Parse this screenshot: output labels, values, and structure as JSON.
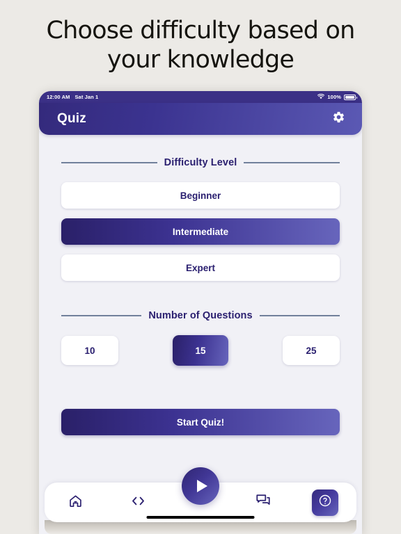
{
  "headline": "Choose difficulty based on your knowledge",
  "status_bar": {
    "time": "12:00 AM",
    "date": "Sat Jan 1",
    "battery_percent": "100%",
    "wifi_icon": "wifi-icon",
    "battery_icon": "battery-full-icon"
  },
  "app_bar": {
    "title": "Quiz",
    "settings_icon": "gear-icon"
  },
  "difficulty": {
    "section_label": "Difficulty Level",
    "options": [
      {
        "label": "Beginner",
        "selected": false
      },
      {
        "label": "Intermediate",
        "selected": true
      },
      {
        "label": "Expert",
        "selected": false
      }
    ]
  },
  "questions": {
    "section_label": "Number of Questions",
    "options": [
      {
        "label": "10",
        "selected": false
      },
      {
        "label": "15",
        "selected": true
      },
      {
        "label": "25",
        "selected": false
      }
    ]
  },
  "start_button": {
    "label": "Start Quiz!"
  },
  "fab": {
    "icon": "play-icon"
  },
  "bottom_nav": {
    "items": [
      {
        "icon": "home-icon",
        "name": "nav-home"
      },
      {
        "icon": "code-icon",
        "name": "nav-code"
      },
      {
        "icon": "forum-icon",
        "name": "nav-forum"
      },
      {
        "icon": "help-circle-icon",
        "name": "nav-help"
      }
    ]
  },
  "colors": {
    "page_background": "#eceae6",
    "app_background": "#f1f1f6",
    "accent_dark": "#2a2068",
    "accent_light": "#6765bc",
    "text_primary": "#2b2070",
    "rule": "#71809b",
    "status_bar": "#3b3086"
  }
}
